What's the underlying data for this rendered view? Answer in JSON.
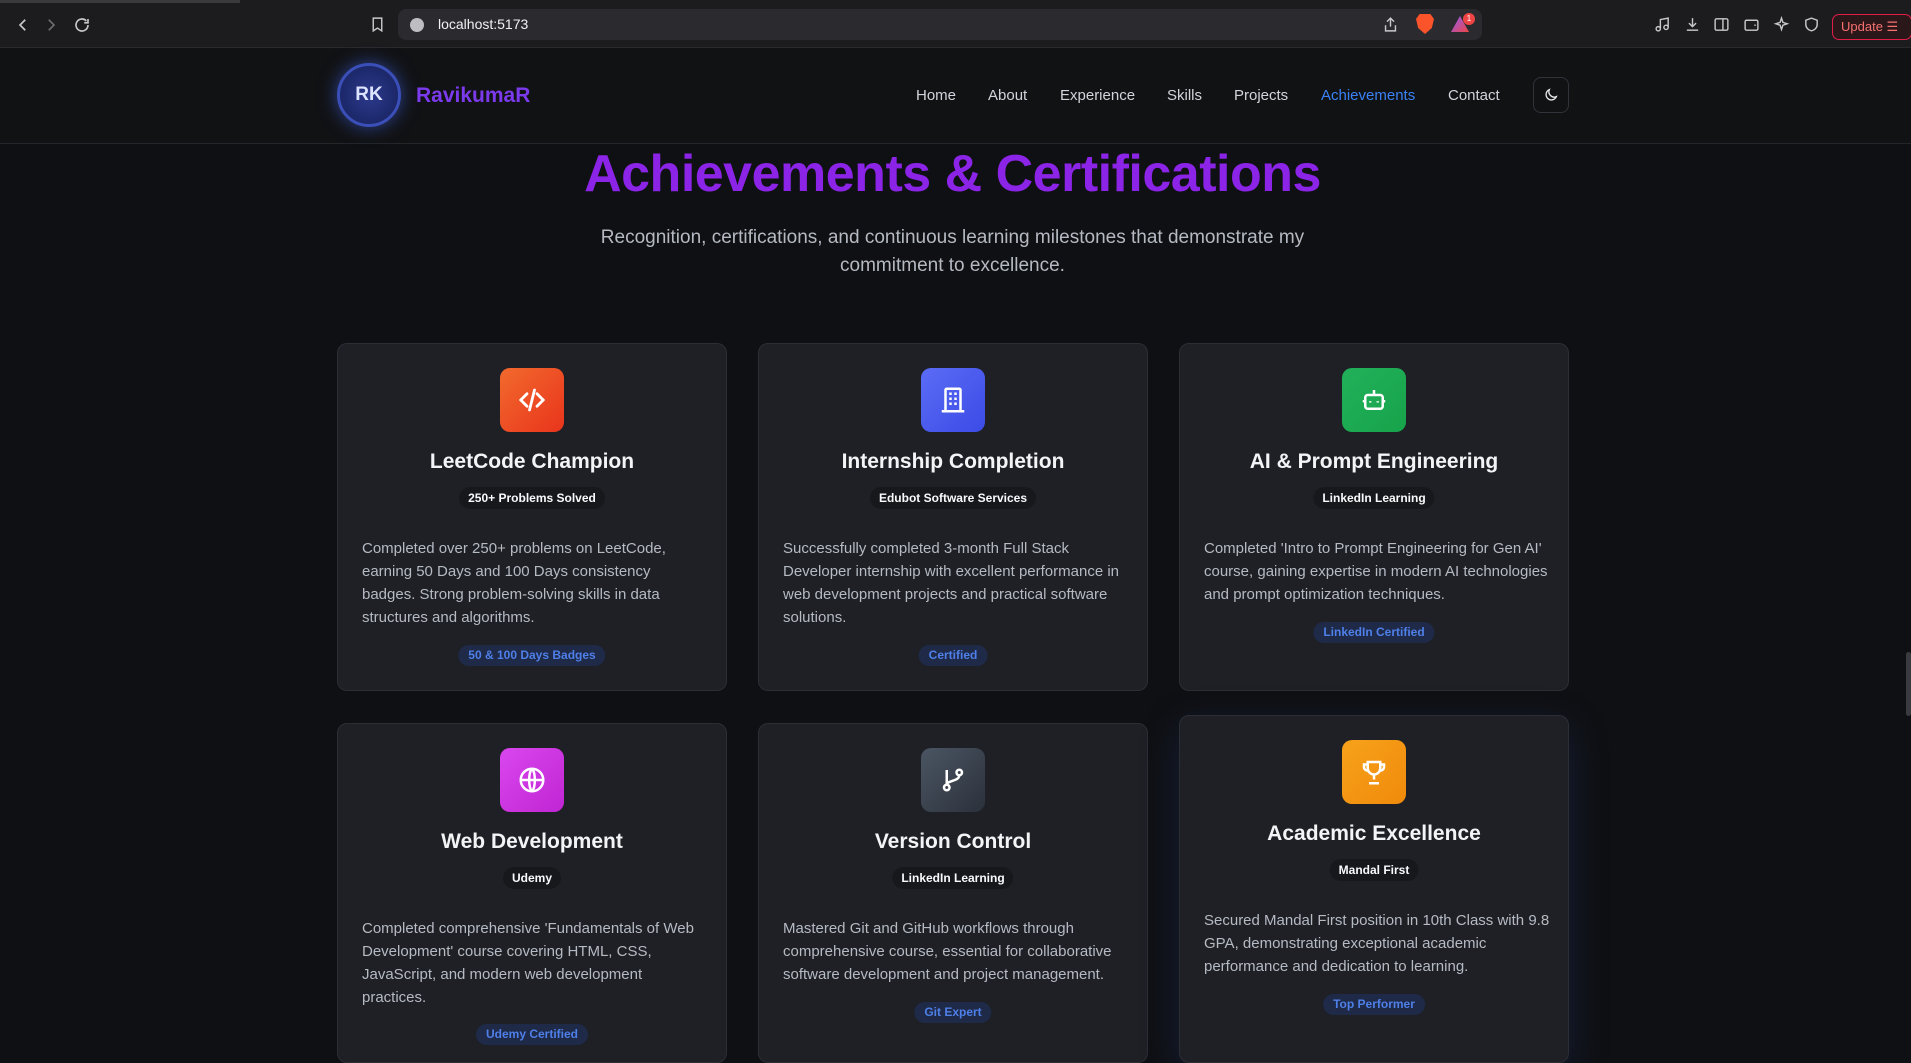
{
  "browser": {
    "url": "localhost:5173",
    "notification_count": "1",
    "update_label": "Update"
  },
  "header": {
    "logo_initials": "RK",
    "brand": "RavikumaR",
    "nav": [
      {
        "label": "Home"
      },
      {
        "label": "About"
      },
      {
        "label": "Experience"
      },
      {
        "label": "Skills"
      },
      {
        "label": "Projects"
      },
      {
        "label": "Achievements",
        "active": true
      },
      {
        "label": "Contact"
      }
    ],
    "accent_color": "#3b82f6"
  },
  "hero": {
    "title": "Achievements & Certifications",
    "subtitle": "Recognition, certifications, and continuous learning milestones that demonstrate my commitment to excellence.",
    "title_color": "#8b24e6"
  },
  "cards": [
    {
      "icon": "code-icon",
      "icon_color": "#f04c23",
      "title": "LeetCode Champion",
      "subtitle": "250+ Problems Solved",
      "description": "Completed over 250+ problems on LeetCode, earning 50 Days and 100 Days consistency badges. Strong problem-solving skills in data structures and algorithms.",
      "tag": "50 & 100 Days Badges"
    },
    {
      "icon": "building-icon",
      "icon_color": "#4a5cf0",
      "title": "Internship Completion",
      "subtitle": "Edubot Software Services",
      "description": "Successfully completed 3-month Full Stack Developer internship with excellent performance in web development projects and practical software solutions.",
      "tag": "Certified"
    },
    {
      "icon": "robot-icon",
      "icon_color": "#16a34a",
      "title": "AI & Prompt Engineering",
      "subtitle": "LinkedIn Learning",
      "description": "Completed 'Intro to Prompt Engineering for Gen AI' course, gaining expertise in modern AI technologies and prompt optimization techniques.",
      "tag": "LinkedIn Certified"
    },
    {
      "icon": "globe-icon",
      "icon_color": "#c026d3",
      "title": "Web Development",
      "subtitle": "Udemy",
      "description": "Completed comprehensive 'Fundamentals of Web Development' course covering HTML, CSS, JavaScript, and modern web development practices.",
      "tag": "Udemy Certified"
    },
    {
      "icon": "git-branch-icon",
      "icon_color": "#374151",
      "title": "Version Control",
      "subtitle": "LinkedIn Learning",
      "description": "Mastered Git and GitHub workflows through comprehensive course, essential for collaborative software development and project management.",
      "tag": "Git Expert"
    },
    {
      "icon": "trophy-icon",
      "icon_color": "#f59e0b",
      "title": "Academic Excellence",
      "subtitle": "Mandal First",
      "description": "Secured Mandal First position in 10th Class with 9.8 GPA, demonstrating exceptional academic performance and dedication to learning.",
      "tag": "Top Performer"
    }
  ]
}
